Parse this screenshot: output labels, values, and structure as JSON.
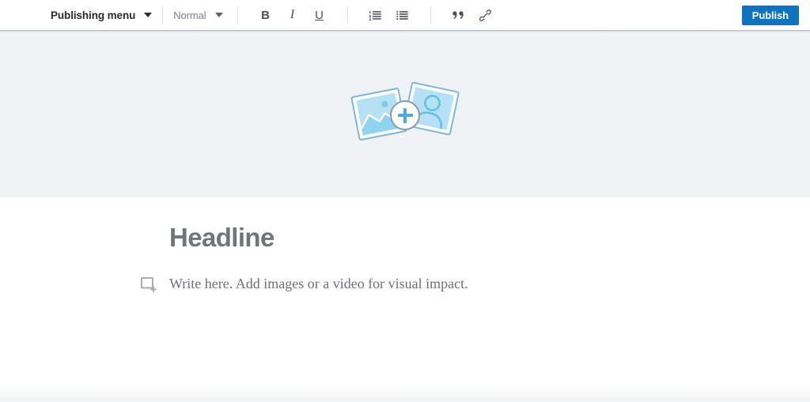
{
  "toolbar": {
    "publishing_menu": {
      "label": "Publishing menu",
      "caret_icon": "chevron-down-icon"
    },
    "style_select": {
      "value": "Normal",
      "caret_icon": "chevron-down-icon"
    },
    "format_buttons": [
      {
        "name": "bold",
        "label": "B",
        "icon": "bold-icon"
      },
      {
        "name": "italic",
        "label": "I",
        "icon": "italic-icon"
      },
      {
        "name": "underline",
        "label": "U",
        "icon": "underline-icon"
      }
    ],
    "list_buttons": [
      {
        "name": "numbered-list",
        "label": "",
        "icon": "numbered-list-icon"
      },
      {
        "name": "bulleted-list",
        "label": "",
        "icon": "bulleted-list-icon"
      }
    ],
    "insert_buttons": [
      {
        "name": "blockquote",
        "label": "",
        "icon": "quote-icon"
      },
      {
        "name": "link",
        "label": "",
        "icon": "link-icon"
      }
    ],
    "publish_label": "Publish",
    "publish_color": "#0f73bd"
  },
  "hero": {
    "add_media_icon": "add-photos-icon",
    "plus_icon": "plus-icon",
    "background_color": "#eff3f6",
    "photo_border_color": "#7fb6da",
    "photo_fill_color": "#b6e0f3",
    "plus_color": "#4fa9dd"
  },
  "article": {
    "headline": "Headline",
    "headline_color": "#6f757b",
    "insert_icon": "add-content-icon",
    "body_placeholder": "Write here. Add images or a video for visual impact.",
    "body_color": "#6c7077"
  }
}
